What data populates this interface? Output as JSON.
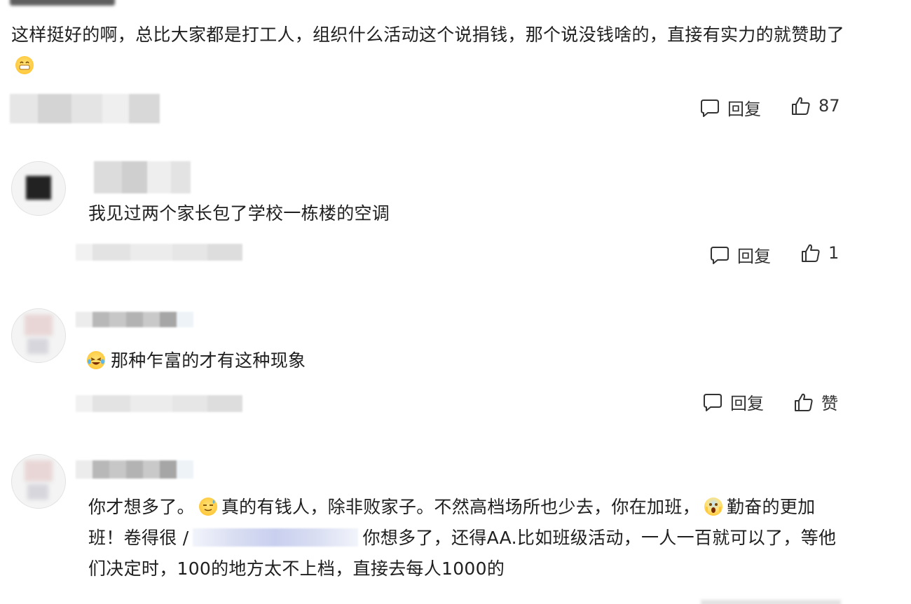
{
  "top_comment": {
    "text_before_emoji": "这样挺好的啊，总比大家都是打工人，组织什么活动这个说捐钱，那个说没钱啥的，直接有实力的就赞助了",
    "emoji_icon": "grinning-emoji-icon",
    "reply_label": "回复",
    "like_count": "87"
  },
  "replies": [
    {
      "text": "我见过两个家长包了学校一栋楼的空调",
      "reply_label": "回复",
      "like_count": "1"
    },
    {
      "emoji_icon": "laughing-crying-emoji-icon",
      "text": "那种乍富的才有这种现象",
      "reply_label": "回复",
      "like_label": "赞"
    },
    {
      "segment_1": "你才想多了。",
      "emoji_1": "sweat-smile-emoji-icon",
      "segment_2": "真的有钱人，除非败家子。不然高档场所也少去，你在加班，",
      "emoji_2": "scream-emoji-icon",
      "segment_3": "勤奋的更加班！卷得很 /",
      "segment_4": "你想多了，还得AA.比如班级活动，一人一百就可以了，等他们决定时，100的地方太不上档，直接去每人1000的"
    }
  ],
  "colors": {
    "text": "#1f1f1f",
    "action_text": "#333333",
    "redaction_gray": "#d8d8d8",
    "redaction_blue": "#c9d0ef"
  }
}
